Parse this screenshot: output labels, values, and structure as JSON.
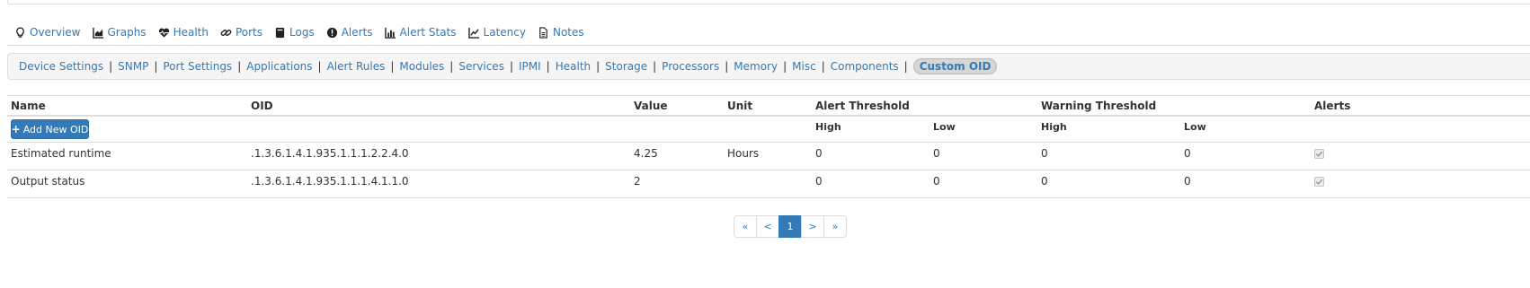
{
  "tabs": [
    {
      "label": "Overview",
      "icon": "lightbulb-icon"
    },
    {
      "label": "Graphs",
      "icon": "area-chart-icon"
    },
    {
      "label": "Health",
      "icon": "heartbeat-icon"
    },
    {
      "label": "Ports",
      "icon": "link-icon"
    },
    {
      "label": "Logs",
      "icon": "book-icon"
    },
    {
      "label": "Alerts",
      "icon": "exclamation-circle-icon"
    },
    {
      "label": "Alert Stats",
      "icon": "bar-chart-icon"
    },
    {
      "label": "Latency",
      "icon": "line-chart-icon"
    },
    {
      "label": "Notes",
      "icon": "file-text-icon"
    }
  ],
  "subnav": {
    "items": [
      "Device Settings",
      "SNMP",
      "Port Settings",
      "Applications",
      "Alert Rules",
      "Modules",
      "Services",
      "IPMI",
      "Health",
      "Storage",
      "Processors",
      "Memory",
      "Misc",
      "Components"
    ],
    "separator": "|",
    "active": "Custom OID"
  },
  "table": {
    "headers": {
      "name": "Name",
      "oid": "OID",
      "value": "Value",
      "unit": "Unit",
      "alert_threshold": "Alert Threshold",
      "warning_threshold": "Warning Threshold",
      "alerts": "Alerts"
    },
    "sub_headers": {
      "alert_high": "High",
      "alert_low": "Low",
      "warn_high": "High",
      "warn_low": "Low"
    },
    "add_button": {
      "plus": "+",
      "label": "Add New OID"
    },
    "rows": [
      {
        "name": "Estimated runtime",
        "oid": ".1.3.6.1.4.1.935.1.1.1.2.2.4.0",
        "value": "4.25",
        "unit": "Hours",
        "alert_high": "0",
        "alert_low": "0",
        "warn_high": "0",
        "warn_low": "0",
        "alerts_checked": true
      },
      {
        "name": "Output status",
        "oid": ".1.3.6.1.4.1.935.1.1.1.4.1.1.0",
        "value": "2",
        "unit": "",
        "alert_high": "0",
        "alert_low": "0",
        "warn_high": "0",
        "warn_low": "0",
        "alerts_checked": true
      }
    ]
  },
  "pagination": {
    "first": "«",
    "prev": "<",
    "current": "1",
    "next": ">",
    "last": "»"
  },
  "colors": {
    "link": "#337ab7",
    "primary_button": "#337ab7",
    "border": "#dddddd"
  }
}
